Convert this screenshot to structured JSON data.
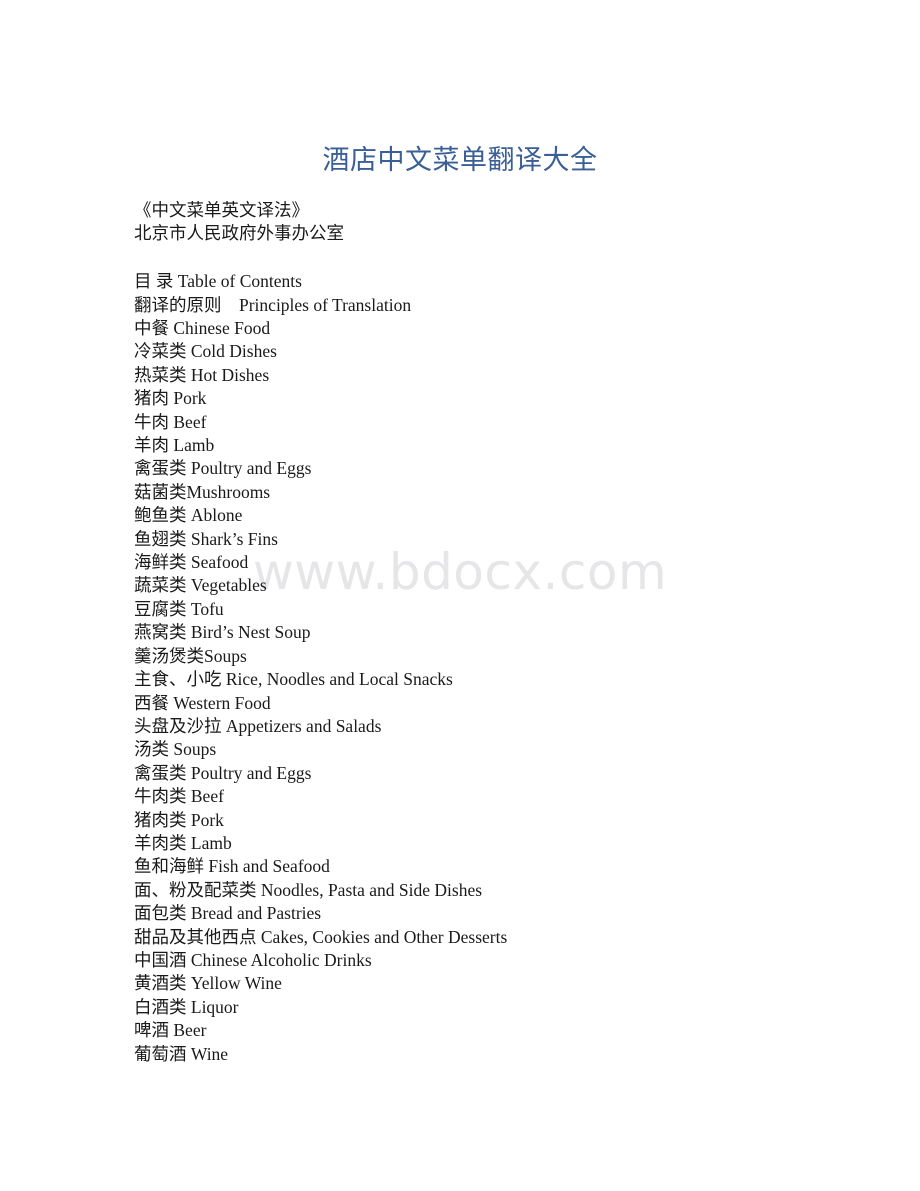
{
  "document": {
    "title": "酒店中文菜单翻译大全",
    "title_color": "#3a5f96",
    "body_color": "#1a1a1a",
    "background_color": "#ffffff",
    "header_lines": [
      "《中文菜单英文译法》",
      "北京市人民政府外事办公室"
    ],
    "toc_items": [
      "目 录 Table of Contents",
      "翻译的原则    Principles of Translation",
      "中餐 Chinese Food",
      "冷菜类 Cold Dishes",
      "热菜类 Hot Dishes",
      "猪肉 Pork",
      "牛肉 Beef",
      "羊肉 Lamb",
      "禽蛋类 Poultry and Eggs",
      "菇菌类Mushrooms",
      "鲍鱼类 Ablone",
      "鱼翅类 Shark’s Fins",
      "海鲜类 Seafood",
      "蔬菜类 Vegetables",
      "豆腐类 Tofu",
      "燕窝类 Bird’s Nest Soup",
      "羹汤煲类Soups",
      "主食、小吃 Rice, Noodles and Local Snacks",
      "西餐 Western Food",
      "头盘及沙拉 Appetizers and Salads",
      "汤类 Soups",
      "禽蛋类 Poultry and Eggs",
      "牛肉类 Beef",
      "猪肉类 Pork",
      "羊肉类 Lamb",
      "鱼和海鲜 Fish and Seafood",
      "面、粉及配菜类 Noodles, Pasta and Side Dishes",
      "面包类 Bread and Pastries",
      "甜品及其他西点 Cakes, Cookies and Other Desserts",
      "中国酒 Chinese Alcoholic Drinks",
      "黄酒类 Yellow Wine",
      "白酒类 Liquor",
      "啤酒 Beer",
      "葡萄酒 Wine"
    ]
  },
  "watermark": {
    "text": "www.bdocx.com",
    "color": "#e6e6e8"
  }
}
